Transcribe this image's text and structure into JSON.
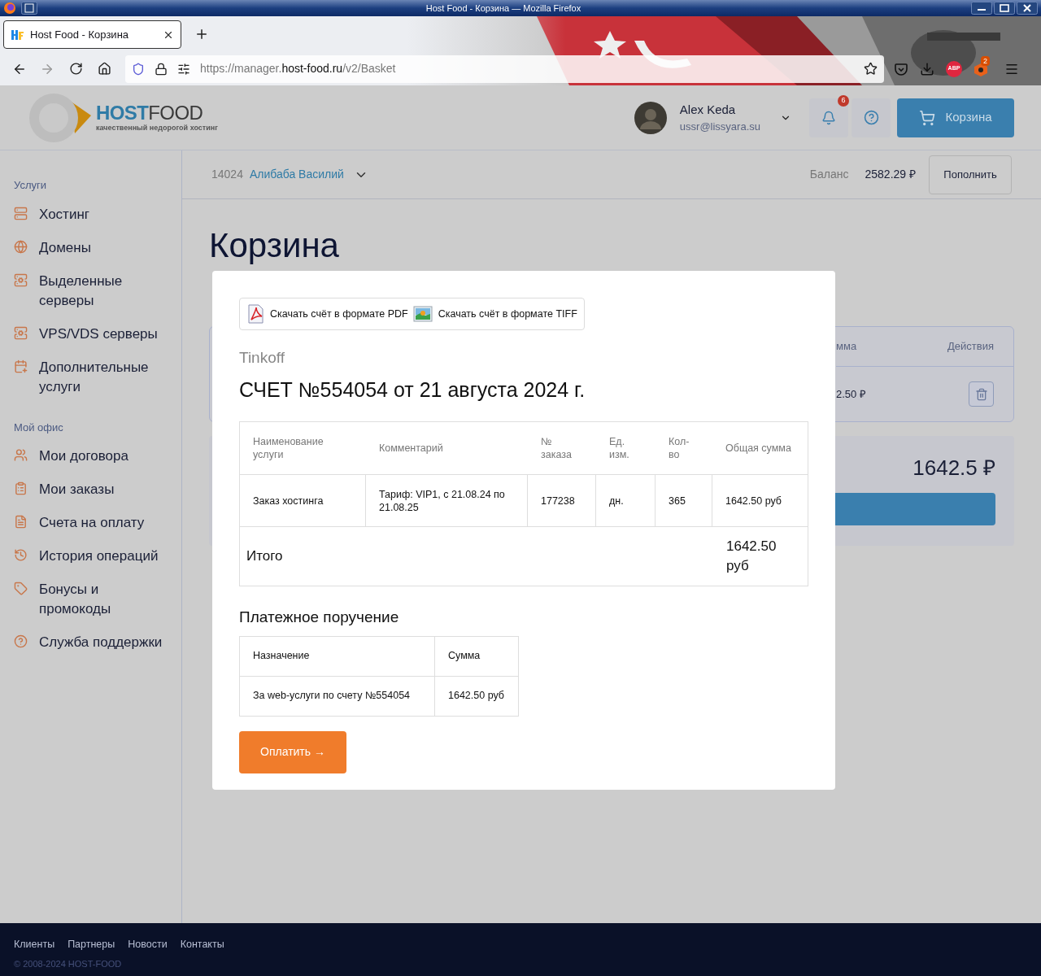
{
  "window": {
    "title": "Host Food - Корзина — Mozilla Firefox"
  },
  "browser": {
    "tabs": [
      {
        "title": "Host Food - Корзина",
        "selected": true
      }
    ],
    "url": {
      "scheme": "https://manager.",
      "domain": "host-food.ru",
      "path": "/v2/Basket"
    },
    "adblock_label": "ABP",
    "extension_badge": "2"
  },
  "header": {
    "logo": {
      "brand_strong": "HOST",
      "brand_light": "FOOD",
      "tagline": "качественный недорогой хостинг"
    },
    "user": {
      "name": "Alex Keda",
      "email": "ussr@lissyara.su"
    },
    "notifications_badge": "6",
    "cart_button": "Корзина"
  },
  "account_bar": {
    "account_id": "14024",
    "account_name": "Алибаба Василий",
    "balance_label": "Баланс",
    "balance": "2582.29 ₽",
    "topup_button": "Пополнить"
  },
  "sidebar": {
    "sections": [
      {
        "title": "Услуги",
        "items": [
          {
            "label": "Хостинг"
          },
          {
            "label": "Домены"
          },
          {
            "label": "Выделенные серверы"
          },
          {
            "label": "VPS/VDS серверы"
          },
          {
            "label": "Дополнительные услуги"
          }
        ]
      },
      {
        "title": "Мой офис",
        "items": [
          {
            "label": "Мои договора"
          },
          {
            "label": "Мои заказы"
          },
          {
            "label": "Счета на оплату"
          },
          {
            "label": "История операций"
          },
          {
            "label": "Бонусы и промокоды"
          },
          {
            "label": "Служба поддержки"
          }
        ]
      }
    ]
  },
  "page": {
    "heading": "Корзина",
    "cart_table": {
      "columns": [
        "мма",
        "Действия"
      ],
      "rows": [
        {
          "amount": "2.50 ₽"
        }
      ]
    },
    "total": "1642.5 ₽"
  },
  "modal": {
    "downloads": [
      {
        "label": "Скачать счёт в формате PDF",
        "kind": "pdf"
      },
      {
        "label": "Скачать счёт в формате TIFF",
        "kind": "tiff"
      }
    ],
    "bank": "Tinkoff",
    "title": "СЧЕТ №554054 от 21 августа 2024 г.",
    "invoice_table": {
      "columns": [
        "Наименование услуги",
        "Комментарий",
        "№ заказа",
        "Ед. изм.",
        "Кол-во",
        "Общая сумма"
      ],
      "rows": [
        [
          "Заказ хостинга",
          "Тариф: VIP1, с 21.08.24 по 21.08.25",
          "177238",
          "дн.",
          "365",
          "1642.50 руб"
        ]
      ],
      "total_label": "Итого",
      "total": "1642.50 руб"
    },
    "payment_order": {
      "title": "Платежное поручение",
      "columns": [
        "Назначение",
        "Сумма"
      ],
      "rows": [
        [
          "За web-услуги по счету №554054",
          "1642.50 руб"
        ]
      ]
    },
    "pay_button": "Оплатить →"
  },
  "footer": {
    "links": [
      "Клиенты",
      "Партнеры",
      "Новости",
      "Контакты"
    ],
    "copyright": "© 2008-2024 HOST-FOOD"
  }
}
